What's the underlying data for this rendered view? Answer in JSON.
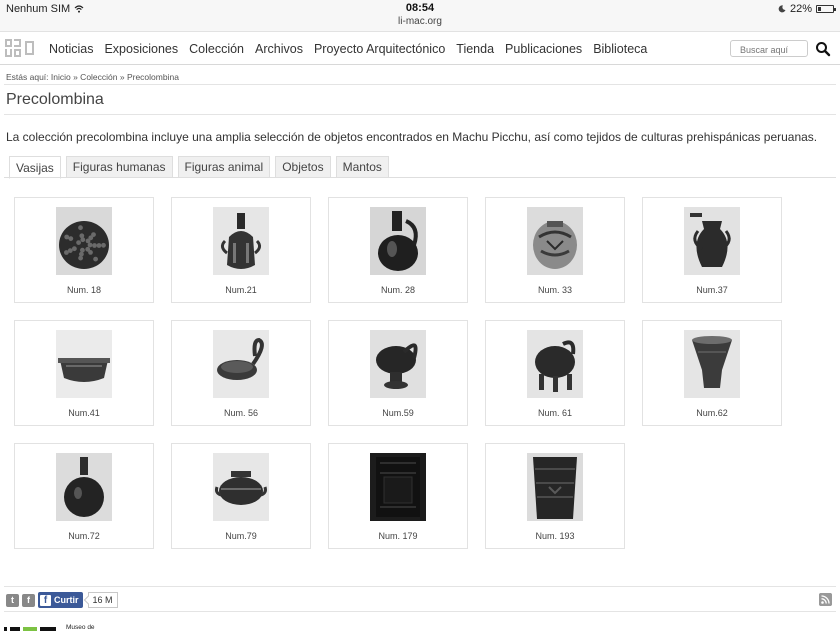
{
  "status": {
    "carrier": "Nenhum SIM",
    "time": "08:54",
    "url": "li-mac.org",
    "battery": "22%"
  },
  "nav": {
    "items": [
      "Noticias",
      "Exposiciones",
      "Colección",
      "Archivos",
      "Proyecto Arquitectónico",
      "Tienda",
      "Publicaciones",
      "Biblioteca"
    ],
    "search_placeholder": "Buscar aquí"
  },
  "breadcrumb": "Estás aquí: Inicio » Colección » Precolombina",
  "page": {
    "title": "Precolombina",
    "intro": "La colección precolombina incluye una amplia selección de objetos encontrados en Machu Picchu, así como tejidos de culturas prehispánicas peruanas."
  },
  "tabs": [
    {
      "label": "Vasijas",
      "active": true
    },
    {
      "label": "Figuras humanas",
      "active": false
    },
    {
      "label": "Figuras animal",
      "active": false
    },
    {
      "label": "Objetos",
      "active": false
    },
    {
      "label": "Mantos",
      "active": false
    }
  ],
  "items": [
    {
      "label": "Num. 18",
      "shape": "round-dotted"
    },
    {
      "label": "Num.21",
      "shape": "bottle-handles"
    },
    {
      "label": "Num. 28",
      "shape": "jug"
    },
    {
      "label": "Num. 33",
      "shape": "painted-jar"
    },
    {
      "label": "Num.37",
      "shape": "amphora"
    },
    {
      "label": "Num.41",
      "shape": "bowl"
    },
    {
      "label": "Num. 56",
      "shape": "dipper"
    },
    {
      "label": "Num.59",
      "shape": "pedestal-handle"
    },
    {
      "label": "Num. 61",
      "shape": "tripod"
    },
    {
      "label": "Num.62",
      "shape": "goblet"
    },
    {
      "label": "Num.72",
      "shape": "stirrup"
    },
    {
      "label": "Num.79",
      "shape": "small-pot"
    },
    {
      "label": "Num. 179",
      "shape": "beaker-dark"
    },
    {
      "label": "Num. 193",
      "shape": "kero"
    }
  ],
  "share": {
    "like_label": "Curtir",
    "like_count": "16 M"
  },
  "footer": {
    "text": "Museo de"
  },
  "colors": {
    "facebook": "#3b5998",
    "border": "#e2e2e2"
  }
}
